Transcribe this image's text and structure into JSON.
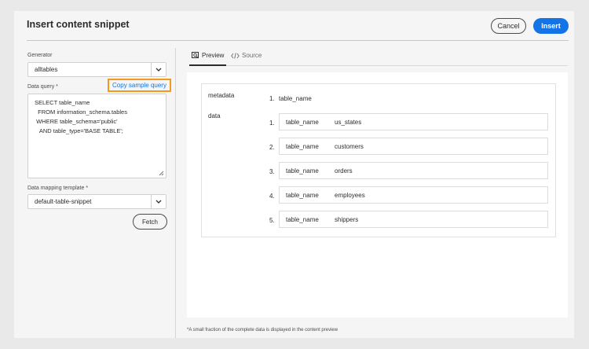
{
  "dialog": {
    "title": "Insert content snippet",
    "cancel_label": "Cancel",
    "insert_label": "Insert"
  },
  "left": {
    "generator_label": "Generator",
    "generator_value": "alltables",
    "data_query_label": "Data query *",
    "copy_sample_label": "Copy sample query",
    "query_lines": [
      "SELECT table_name",
      "  FROM information_schema.tables",
      " WHERE table_schema='public'",
      "   AND table_type='BASE TABLE';"
    ],
    "mapping_label": "Data mapping template *",
    "mapping_value": "default-table-snippet",
    "fetch_label": "Fetch"
  },
  "tabs": {
    "preview": "Preview",
    "source": "Source"
  },
  "preview": {
    "metadata_label": "metadata",
    "metadata_item_num": "1.",
    "metadata_item": "table_name",
    "data_label": "data",
    "rows": [
      {
        "num": "1.",
        "key": "table_name",
        "value": "us_states"
      },
      {
        "num": "2.",
        "key": "table_name",
        "value": "customers"
      },
      {
        "num": "3.",
        "key": "table_name",
        "value": "orders"
      },
      {
        "num": "4.",
        "key": "table_name",
        "value": "employees"
      },
      {
        "num": "5.",
        "key": "table_name",
        "value": "shippers"
      }
    ]
  },
  "footnote": "*A small fraction of the complete data is displayed in the content preview",
  "colors": {
    "accent": "#1473e6",
    "highlight": "#f39a1e"
  },
  "icons": [
    "chevron-down-icon",
    "preview-icon",
    "code-icon",
    "resize-handle-icon"
  ]
}
